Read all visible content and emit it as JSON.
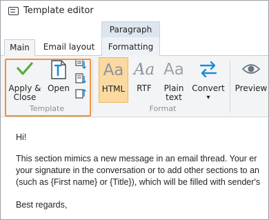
{
  "window": {
    "title": "Template editor"
  },
  "ribbon_tabs": {
    "context_group": "Paragraph",
    "items": [
      {
        "label": "Main",
        "active": true
      },
      {
        "label": "Email layout",
        "active": false
      },
      {
        "label": "Formatting",
        "active": false
      }
    ]
  },
  "ribbon": {
    "template_group": {
      "label": "Template",
      "apply_close": [
        "Apply &",
        "Close"
      ],
      "open": "Open",
      "small_icons": [
        "insert-top-icon",
        "insert-bottom-icon",
        "export-icon"
      ]
    },
    "format_group": {
      "label": "Format",
      "html_glyph": "Aa",
      "html": "HTML",
      "rtf_glyph": "Aa",
      "rtf": "RTF",
      "plain_glyph": "Aa",
      "plain": [
        "Plain",
        "text"
      ],
      "convert": "Convert",
      "convert_arrow": "▾"
    },
    "preview": "Preview",
    "accent_color": "#f0923c"
  },
  "content": {
    "lines": [
      "Hi!",
      "This section mimics a new message in an email thread. Your er",
      "your signature in the conversation or to add other sections to an",
      "(such as {First name} or {Title}), which will be filled with sender's",
      "Best regards,"
    ]
  }
}
